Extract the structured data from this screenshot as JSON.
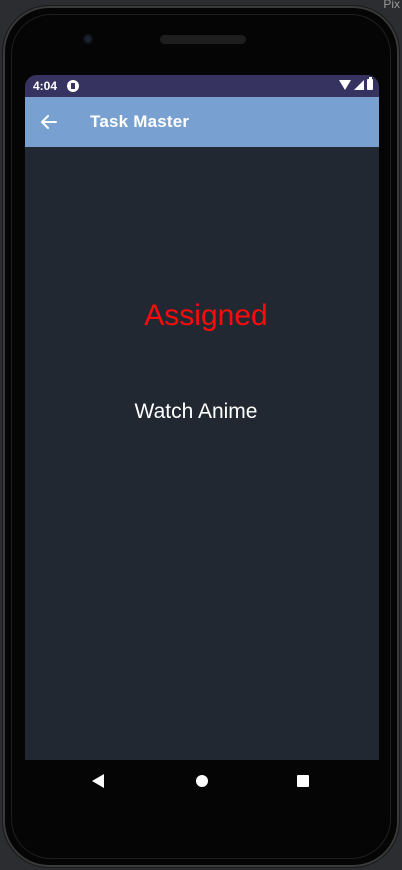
{
  "status_bar": {
    "time": "4:04"
  },
  "app_bar": {
    "title": "Task Master"
  },
  "task": {
    "status": "Assigned",
    "name": "Watch Anime"
  },
  "host": {
    "corner_text": "Pix"
  },
  "colors": {
    "status_bar_bg": "#373360",
    "app_bar_bg": "#78a1d1",
    "screen_bg": "#222831",
    "status_text": "#ff0a0a"
  }
}
